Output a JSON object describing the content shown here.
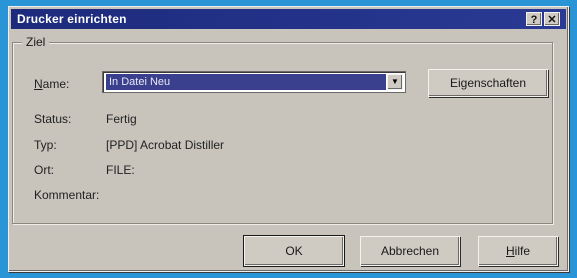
{
  "window": {
    "title": "Drucker einrichten",
    "help_glyph": "?",
    "close_glyph": "✕"
  },
  "group": {
    "legend": "Ziel"
  },
  "fields": {
    "name_label": "Name:",
    "name_value": "In Datei Neu",
    "status_label": "Status:",
    "status_value": "Fertig",
    "type_label": "Typ:",
    "type_value": "[PPD] Acrobat Distiller",
    "location_label": "Ort:",
    "location_value": "FILE:",
    "comment_label": "Kommentar:"
  },
  "buttons": {
    "properties": "Eigenschaften",
    "ok": "OK",
    "cancel": "Abbrechen",
    "help": "Hilfe"
  },
  "icons": {
    "dropdown": "▼"
  },
  "colors": {
    "titlebar": "#1d2a7c",
    "dialog_bg": "#c8c4bc",
    "selection": "#3a3f8e",
    "desktop": "#2a95d6"
  }
}
